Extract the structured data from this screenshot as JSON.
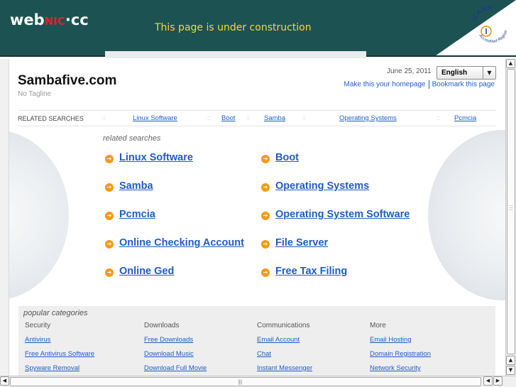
{
  "banner": {
    "logo_web": "web",
    "logo_nic": "NIC",
    "logo_dot": "·",
    "logo_cc": "cc",
    "notice": "This page is under construction",
    "seal_text": "ICANN",
    "seal_subtext": "Accredited Registrar"
  },
  "header": {
    "site_title": "Sambafive.com",
    "tagline": "No Tagline",
    "date": "June 25, 2011",
    "language": "English",
    "make_homepage": "Make this your homepage",
    "bookmark": "Bookmark this page"
  },
  "related_bar": {
    "label": "RELATED SEARCHES",
    "separator": "::",
    "links": [
      "Linux Software",
      "Boot",
      "Samba",
      "Operating Systems",
      "Pcmcia"
    ]
  },
  "related": {
    "heading": "related searches",
    "left": [
      "Linux Software",
      "Samba",
      "Pcmcia",
      "Online Checking Account",
      "Online Ged"
    ],
    "right": [
      "Boot",
      "Operating Systems",
      "Operating System Software",
      "File Server",
      "Free Tax Filing"
    ]
  },
  "popular": {
    "title": "popular categories",
    "columns": [
      {
        "heading": "Security",
        "links": [
          "Antivirus",
          "Free Antivirus Software",
          "Spyware Removal"
        ]
      },
      {
        "heading": "Downloads",
        "links": [
          "Free Downloads",
          "Download Music",
          "Download Full Movie"
        ]
      },
      {
        "heading": "Communications",
        "links": [
          "Email Account",
          "Chat",
          "Instant Messenger"
        ]
      },
      {
        "heading": "More",
        "links": [
          "Email Hosting",
          "Domain Registration",
          "Network Security"
        ]
      }
    ]
  },
  "colors": {
    "banner": "#1d5252",
    "notice": "#ffd23a",
    "link": "#1f5cc4",
    "bullet": "#f59a16"
  },
  "icons": {
    "bullet": "arrow-circle-icon",
    "scroll_up": "triangle-up-icon",
    "scroll_down": "triangle-down-icon",
    "scroll_left": "triangle-left-icon",
    "scroll_right": "triangle-right-icon",
    "dropdown": "chevron-down-icon"
  }
}
